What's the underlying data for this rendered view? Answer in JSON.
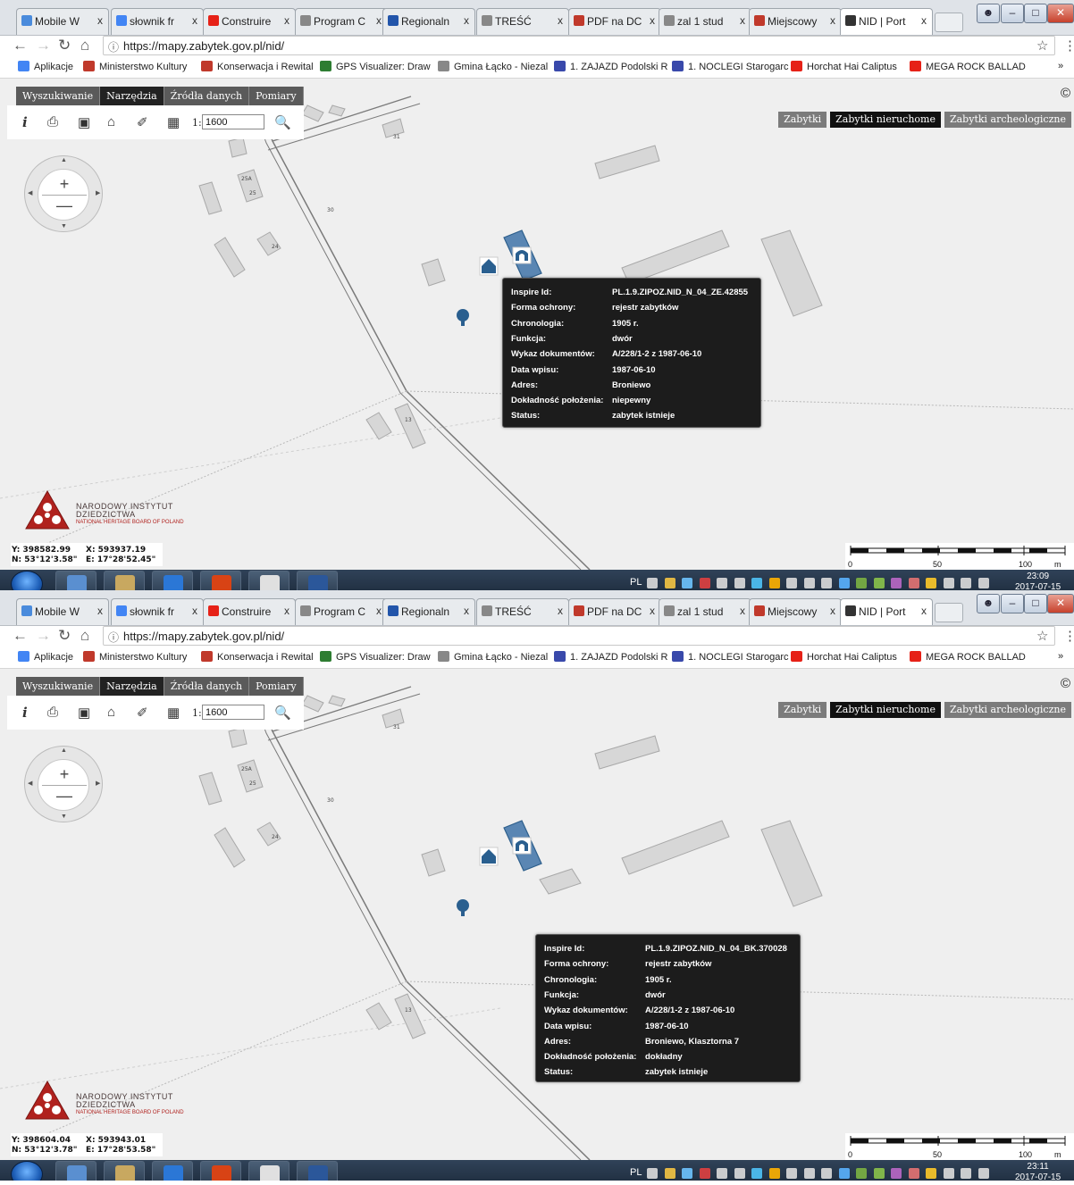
{
  "browser": {
    "tabs": [
      {
        "label": "Mobile W",
        "icon_color": "#4a8bdc"
      },
      {
        "label": "słownik fr",
        "icon_color": "#4285f4"
      },
      {
        "label": "Construire",
        "icon_color": "#e62117"
      },
      {
        "label": "Program C",
        "icon_color": "#888888"
      },
      {
        "label": "Regionaln",
        "icon_color": "#2255aa"
      },
      {
        "label": "TREŚĆ",
        "icon_color": "#888888"
      },
      {
        "label": "PDF na DC",
        "icon_color": "#c0392b"
      },
      {
        "label": "zal 1 stud",
        "icon_color": "#888888"
      },
      {
        "label": "Miejscowy",
        "icon_color": "#c0392b"
      },
      {
        "label": "NID | Port",
        "icon_color": "#333333"
      }
    ],
    "tab_close": "x",
    "url": "https://mapy.zabytek.gov.pl/nid/",
    "bookmarks": [
      {
        "label": "Aplikacje",
        "color": "#4285f4"
      },
      {
        "label": "Ministerstwo Kultury",
        "color": "#c0392b"
      },
      {
        "label": "Konserwacja i Rewital",
        "color": "#c0392b"
      },
      {
        "label": "GPS Visualizer: Draw",
        "color": "#2e7d32"
      },
      {
        "label": "Gmina Łącko - Niezal",
        "color": "#888888"
      },
      {
        "label": "1. ZAJAZD Podolski R",
        "color": "#3949ab"
      },
      {
        "label": "1. NOCLEGI Starogarc",
        "color": "#3949ab"
      },
      {
        "label": "Horchat Hai Caliptus",
        "color": "#e62117"
      },
      {
        "label": "MEGA ROCK BALLAD",
        "color": "#e62117"
      }
    ],
    "bookmarks_more": "»"
  },
  "app": {
    "menu": [
      "Wyszukiwanie",
      "Narzędzia",
      "Źródła danych",
      "Pomiary"
    ],
    "active_menu": "Narzędzia",
    "copyright": "©",
    "scale_prefix": "1:",
    "scale_value": "1600",
    "layers": [
      "Zabytki",
      "Zabytki nieruchome",
      "Zabytki archeologiczne"
    ],
    "active_layer": "Zabytki nieruchome",
    "logo": {
      "line1": "NARODOWY INSTYTUT",
      "line2": "DZIEDZICTWA",
      "line3": "NATIONAL HERITAGE BOARD OF POLAND"
    },
    "scalebar": {
      "labels": [
        "0",
        "50",
        "100"
      ],
      "unit": "m"
    },
    "map_labels": [
      "31",
      "25A",
      "25",
      "30",
      "24",
      "13"
    ]
  },
  "popup_labels": {
    "inspire": "Inspire Id:",
    "forma": "Forma ochrony:",
    "chronologia": "Chronologia:",
    "funkcja": "Funkcja:",
    "wykaz": "Wykaz dokumentów:",
    "data": "Data wpisu:",
    "adres": "Adres:",
    "dokladnosc": "Dokładność położenia:",
    "status": "Status:"
  },
  "screens": [
    {
      "coords": {
        "y": "Y: 398582.99",
        "x": "X: 593937.19",
        "n": "N: 53°12'3.58\"",
        "e": "E: 17°28'52.45\""
      },
      "popup": {
        "inspire": "PL.1.9.ZIPOZ.NID_N_04_ZE.42855",
        "forma": "rejestr zabytków",
        "chronologia": "1905 r.",
        "funkcja": "dwór",
        "wykaz": "A/228/1-2 z 1987-06-10",
        "data": "1987-06-10",
        "adres": "Broniewo",
        "dokladnosc": "niepewny",
        "status": "zabytek istnieje"
      },
      "tray_lang": "PL",
      "clock_time": "23:09",
      "clock_date": "2017-07-15"
    },
    {
      "coords": {
        "y": "Y: 398604.04",
        "x": "X: 593943.01",
        "n": "N: 53°12'3.78\"",
        "e": "E: 17°28'53.58\""
      },
      "popup": {
        "inspire": "PL.1.9.ZIPOZ.NID_N_04_BK.370028",
        "forma": "rejestr zabytków",
        "chronologia": "1905 r.",
        "funkcja": "dwór",
        "wykaz": "A/228/1-2 z 1987-06-10",
        "data": "1987-06-10",
        "adres": "Broniewo, Klasztorna 7",
        "dokladnosc": "dokładny",
        "status": "zabytek istnieje"
      },
      "tray_lang": "PL",
      "clock_time": "23:11",
      "clock_date": "2017-07-15"
    }
  ]
}
